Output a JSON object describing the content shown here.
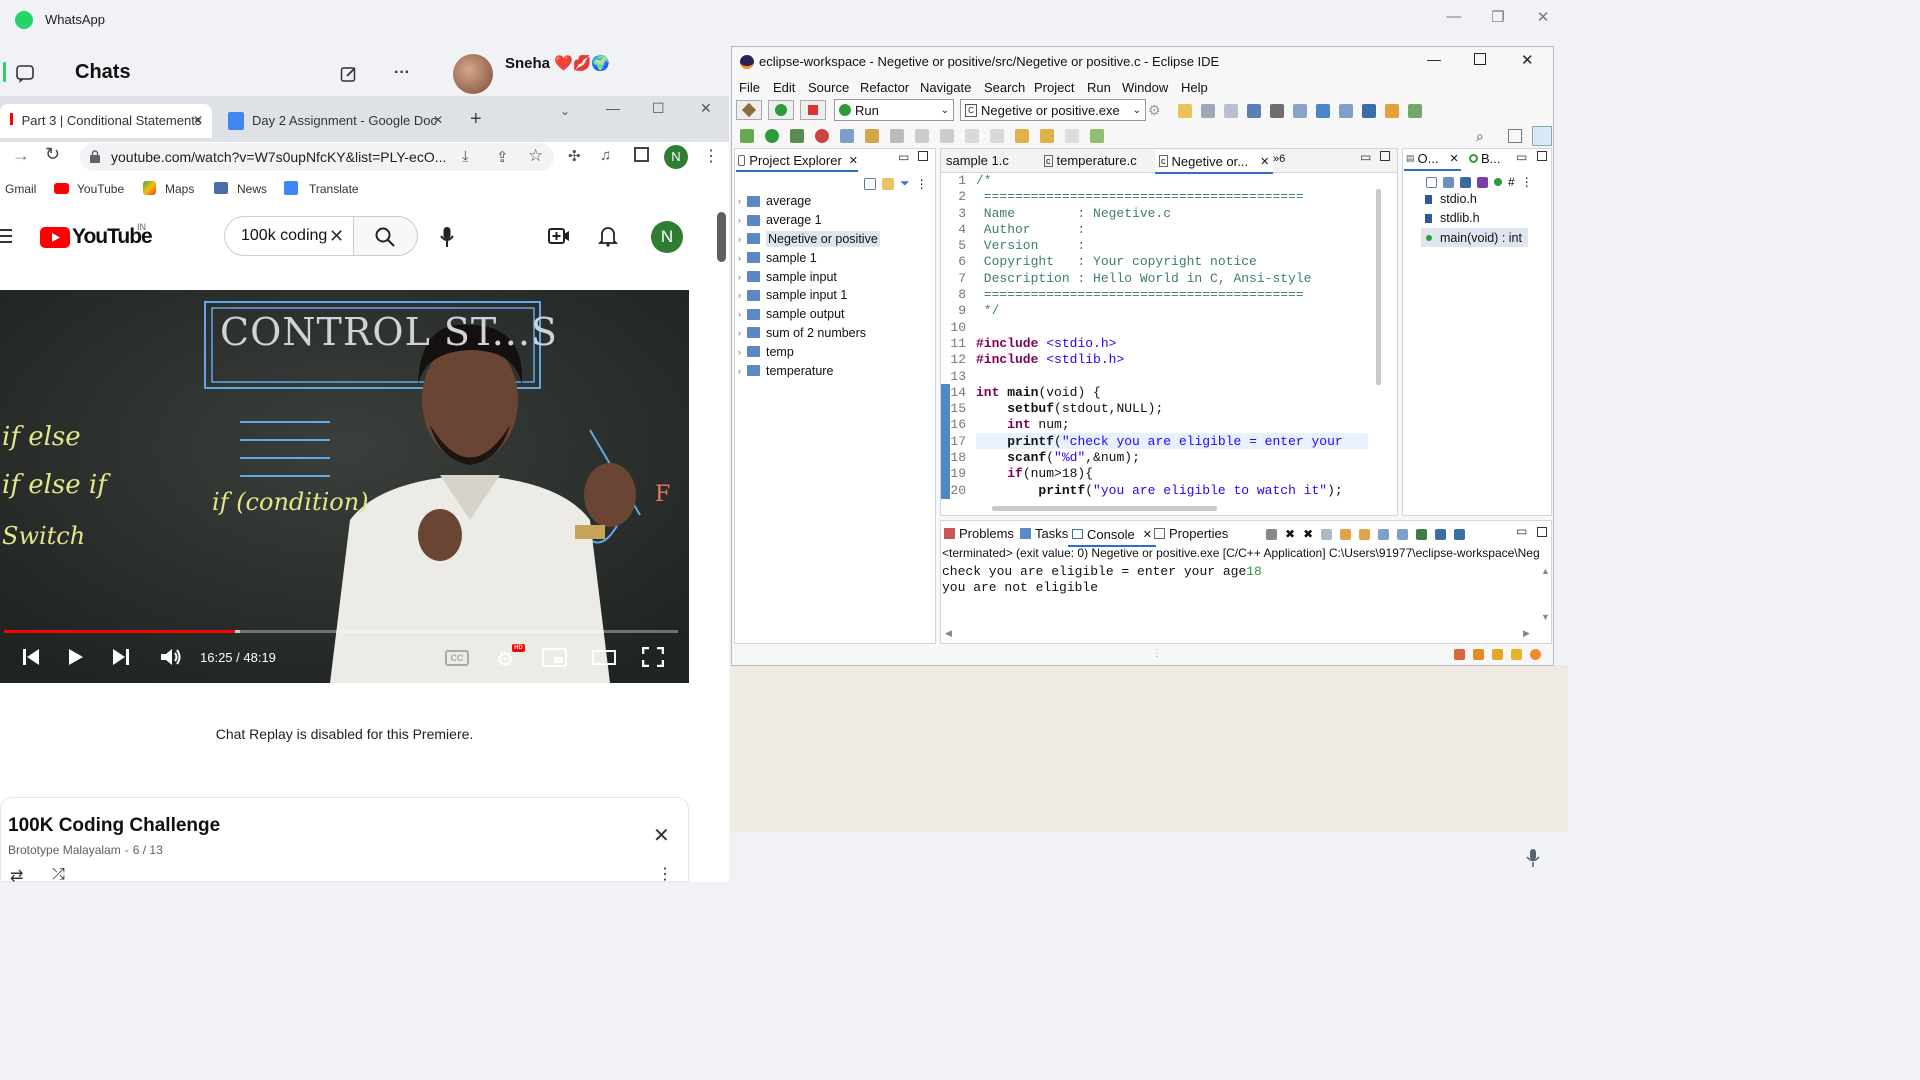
{
  "whatsapp": {
    "title": "WhatsApp",
    "chats_label": "Chats",
    "contact_name": "Sneha",
    "contact_emojis": "❤️💋🌍",
    "window_controls": [
      "minimize-icon",
      "restore-icon",
      "close-icon"
    ]
  },
  "chrome": {
    "tabs": [
      {
        "label": "Part 3 | Conditional Statements",
        "close": "✕"
      },
      {
        "label": "Day 2 Assignment - Google Doc",
        "close": "✕"
      }
    ],
    "new_tab": "+",
    "url": "youtube.com/watch?v=W7s0upNfcKY&list=PLY-ecO...",
    "profile_initial": "N",
    "bookmarks": [
      "Gmail",
      "YouTube",
      "Maps",
      "News",
      "Translate"
    ]
  },
  "youtube": {
    "logo_text": "YouTube",
    "country": "IN",
    "search_value": "100k coding",
    "avatar_initial": "N",
    "video": {
      "time": "16:25 / 48:19",
      "progress": 0.342,
      "buffered": 0.35,
      "board_title": "CONTROL ST...S",
      "board_words": [
        "if else",
        "if else if",
        "Switch",
        "if (condition)",
        "F"
      ]
    },
    "chat_replay": "Chat Replay is disabled for this Premiere.",
    "playlist": {
      "title": "100K Coding Challenge",
      "channel": "Brototype Malayalam",
      "position": "6 / 13"
    }
  },
  "eclipse": {
    "title": "eclipse-workspace - Negetive or positive/src/Negetive or positive.c - Eclipse IDE",
    "menu": [
      "File",
      "Edit",
      "Source",
      "Refactor",
      "Navigate",
      "Search",
      "Project",
      "Run",
      "Window",
      "Help"
    ],
    "run_label": "Run",
    "run_target": "Negetive or positive.exe",
    "project_explorer": {
      "tab": "Project Explorer",
      "items": [
        "average",
        "average 1",
        "Negetive or positive",
        "sample 1",
        "sample input",
        "sample input 1",
        "sample output",
        "sum of 2 numbers",
        "temp",
        "temperature"
      ],
      "selected": "Negetive or positive"
    },
    "editor_tabs": [
      "sample 1.c",
      "temperature.c",
      "Negetive or...",
      "»6"
    ],
    "code_lines": [
      {
        "n": "1",
        "t": "/*"
      },
      {
        "n": "2",
        "t": " ========================================="
      },
      {
        "n": "3",
        "t": " Name        : Negetive.c"
      },
      {
        "n": "4",
        "t": " Author      :"
      },
      {
        "n": "5",
        "t": " Version     :"
      },
      {
        "n": "6",
        "t": " Copyright   : Your copyright notice"
      },
      {
        "n": "7",
        "t": " Description : Hello World in C, Ansi-style"
      },
      {
        "n": "8",
        "t": " ========================================="
      },
      {
        "n": "9",
        "t": " */"
      },
      {
        "n": "10",
        "t": ""
      },
      {
        "n": "11",
        "t": "#include <stdio.h>"
      },
      {
        "n": "12",
        "t": "#include <stdlib.h>"
      },
      {
        "n": "13",
        "t": ""
      },
      {
        "n": "14",
        "t": "int main(void) {"
      },
      {
        "n": "15",
        "t": "    setbuf(stdout,NULL);"
      },
      {
        "n": "16",
        "t": "    int num;"
      },
      {
        "n": "17",
        "t": "    printf(\"check you are eligible = enter your"
      },
      {
        "n": "18",
        "t": "    scanf(\"%d\",&num);"
      },
      {
        "n": "19",
        "t": "    if(num>18){"
      },
      {
        "n": "20",
        "t": "        printf(\"you are eligible to watch it\");"
      }
    ],
    "outline": {
      "tabs": [
        "O...",
        "B..."
      ],
      "items": [
        "stdio.h",
        "stdlib.h",
        "main(void) : int"
      ]
    },
    "bottom_tabs": [
      "Problems",
      "Tasks",
      "Console",
      "Properties"
    ],
    "console": {
      "status": "<terminated> (exit value: 0) Negetive or positive.exe [C/C++ Application] C:\\Users\\91977\\eclipse-workspace\\Neg",
      "line1": "check you are eligible = enter your age",
      "input": "18",
      "line2": "you are not eligible"
    }
  },
  "colors": {
    "whatsapp_green": "#25d366",
    "youtube_red": "#ff0000",
    "eclipse_keyword": "#7f0055",
    "eclipse_string": "#2a00ff",
    "eclipse_comment": "#3f7f5f"
  }
}
